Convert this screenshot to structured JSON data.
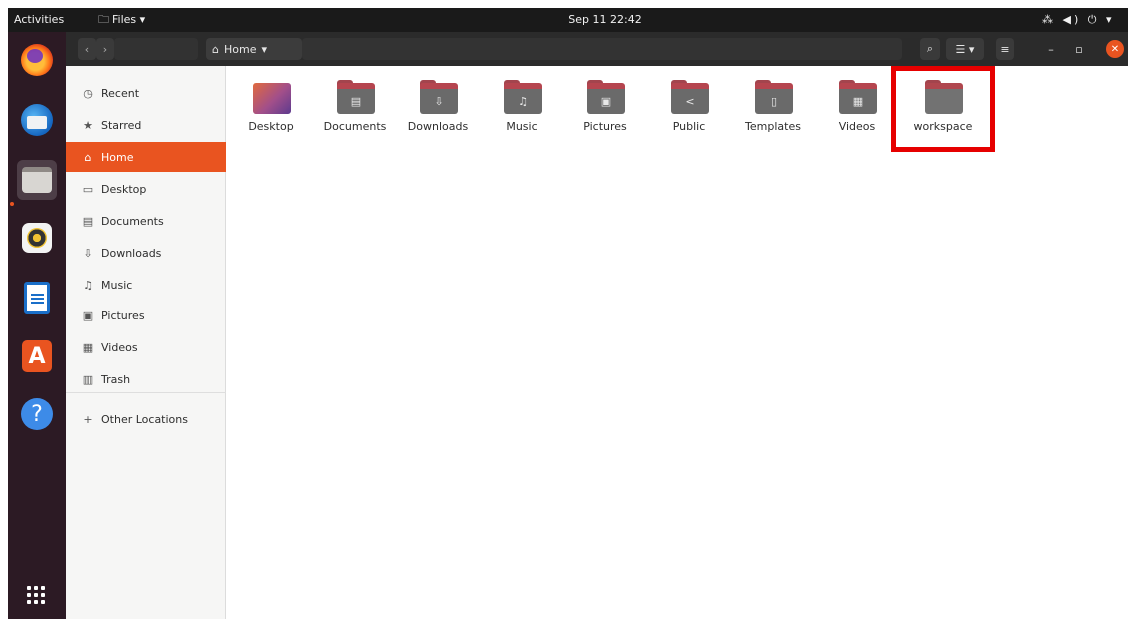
{
  "topbar": {
    "activities": "Activities",
    "app_menu": "Files ▾",
    "clock": "Sep 11  22:42",
    "tray": "⁂ ◀) ⏻ ▾"
  },
  "dock": {
    "apps": [
      "firefox-icon",
      "thunderbird-icon",
      "files-icon",
      "rhythmbox-icon",
      "libreoffice-writer-icon",
      "ubuntu-software-icon",
      "help-icon"
    ],
    "active_app": "files-icon"
  },
  "headerbar": {
    "back": "‹",
    "forward": "›",
    "path_label": "Home",
    "path_icon": "⌂",
    "path_dropdown": "▾",
    "search": "⌕",
    "view_toggle": "☰ ▾",
    "menu": "≡",
    "minimize": "–",
    "maximize": "▫",
    "close": "✕"
  },
  "sidebar": {
    "items": [
      {
        "label": "Recent",
        "icon": "◷"
      },
      {
        "label": "Starred",
        "icon": "★"
      },
      {
        "label": "Home",
        "icon": "⌂"
      },
      {
        "label": "Desktop",
        "icon": "▭"
      },
      {
        "label": "Documents",
        "icon": "▤"
      },
      {
        "label": "Downloads",
        "icon": "⇩"
      },
      {
        "label": "Music",
        "icon": "♫"
      },
      {
        "label": "Pictures",
        "icon": "▣"
      },
      {
        "label": "Videos",
        "icon": "▦"
      },
      {
        "label": "Trash",
        "icon": "▥"
      }
    ],
    "selected": "Home",
    "other_locations": {
      "label": "Other Locations",
      "icon": "+"
    }
  },
  "content": {
    "folders": [
      {
        "label": "Desktop",
        "glyph": ""
      },
      {
        "label": "Documents",
        "glyph": "▤"
      },
      {
        "label": "Downloads",
        "glyph": "⇩"
      },
      {
        "label": "Music",
        "glyph": "♫"
      },
      {
        "label": "Pictures",
        "glyph": "▣"
      },
      {
        "label": "Public",
        "glyph": "<"
      },
      {
        "label": "Templates",
        "glyph": "▯"
      },
      {
        "label": "Videos",
        "glyph": "▦"
      },
      {
        "label": "workspace",
        "glyph": ""
      }
    ],
    "highlighted_folder": "workspace",
    "highlight_color": "#e60000"
  },
  "colors": {
    "accent": "#e95420",
    "dock_bg": "#2c1a24",
    "topbar_bg": "#1a1a1a",
    "headerbar_bg": "#2b2b2b"
  }
}
